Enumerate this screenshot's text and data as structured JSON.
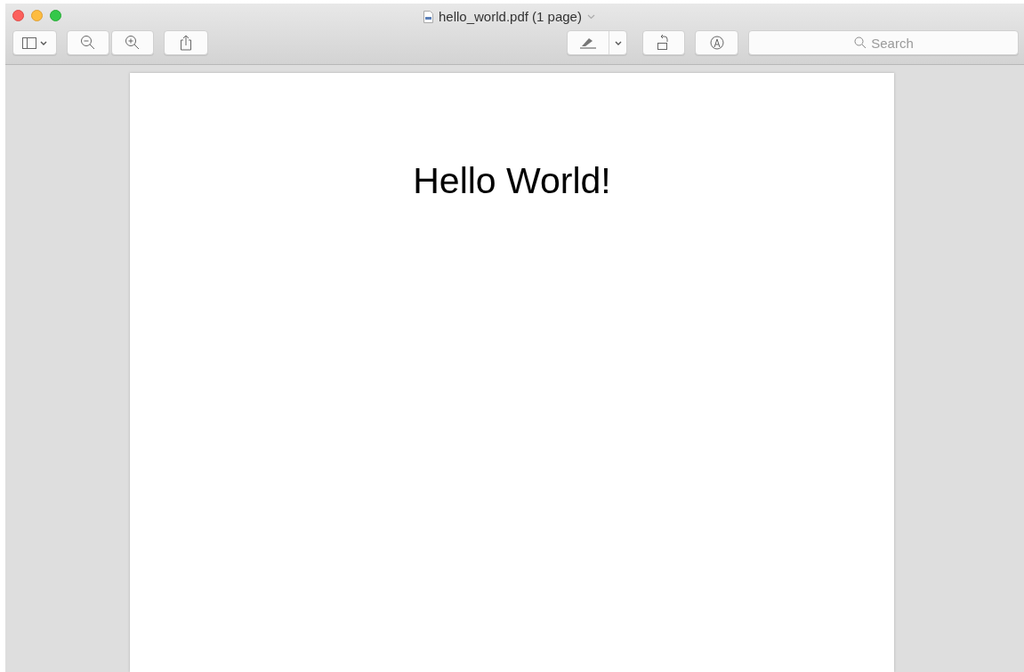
{
  "window": {
    "title": "hello_world.pdf (1 page)"
  },
  "search": {
    "placeholder": "Search"
  },
  "document": {
    "text": "Hello World!"
  }
}
